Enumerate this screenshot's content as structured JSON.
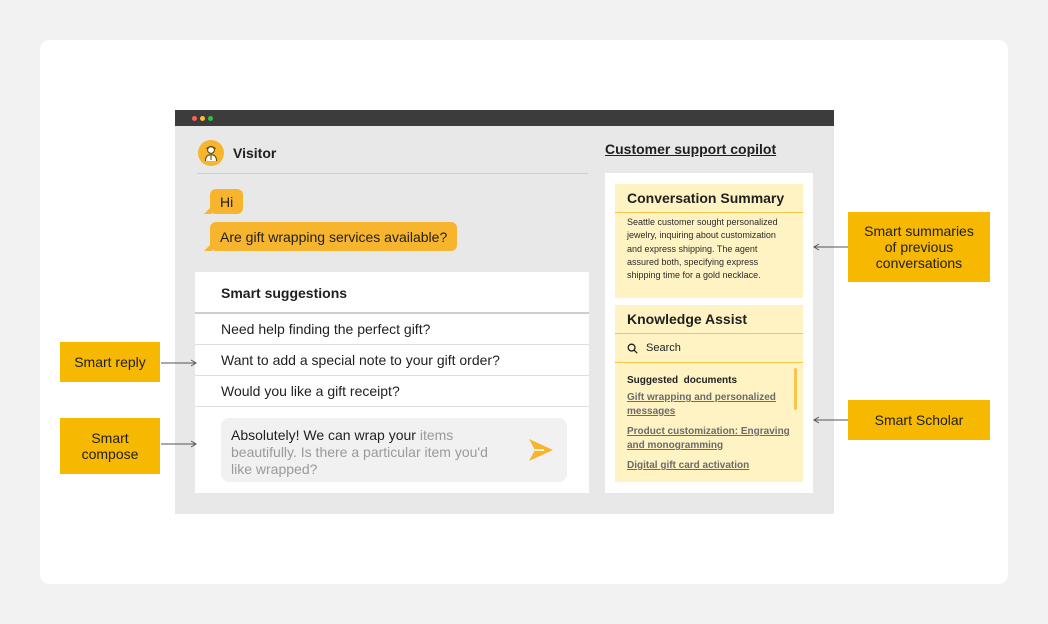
{
  "visitor": {
    "name": "Visitor",
    "icon": "user-avatar-icon"
  },
  "chat": {
    "messages": [
      "Hi",
      "Are gift wrapping services available?"
    ]
  },
  "suggestions": {
    "title": "Smart suggestions",
    "items": [
      "Need help finding the perfect gift?",
      "Want to add a special note to your gift order?",
      "Would you like a gift receipt?"
    ]
  },
  "compose": {
    "typed": "Absolutely! We can wrap your ",
    "ghost": "items beautifully. Is there a particular item you'd like wrapped?",
    "send_icon": "send-icon"
  },
  "copilot": {
    "title": "Customer support copilot",
    "summary": {
      "title": "Conversation Summary",
      "text": "Seattle customer sought personalized jewelry, inquiring about customization and express shipping. The agent assured both, specifying express shipping time for a gold necklace."
    },
    "knowledge": {
      "title": "Knowledge Assist",
      "search_placeholder": "Search",
      "suggested_title": "Suggested  documents",
      "documents": [
        "Gift wrapping and personalized messages",
        "Product customization: Engraving and monogramming",
        "Digital gift card activation"
      ]
    }
  },
  "callouts": {
    "smart_reply": "Smart reply",
    "smart_compose": "Smart compose",
    "smart_summaries": "Smart summaries of previous conversations",
    "smart_scholar": "Smart Scholar"
  },
  "colors": {
    "accent": "#f6b52c",
    "callout": "#f6b800",
    "panel_highlight": "#fff3c4",
    "window_bg": "#e8e8e8",
    "titlebar": "#3c3c3c"
  }
}
